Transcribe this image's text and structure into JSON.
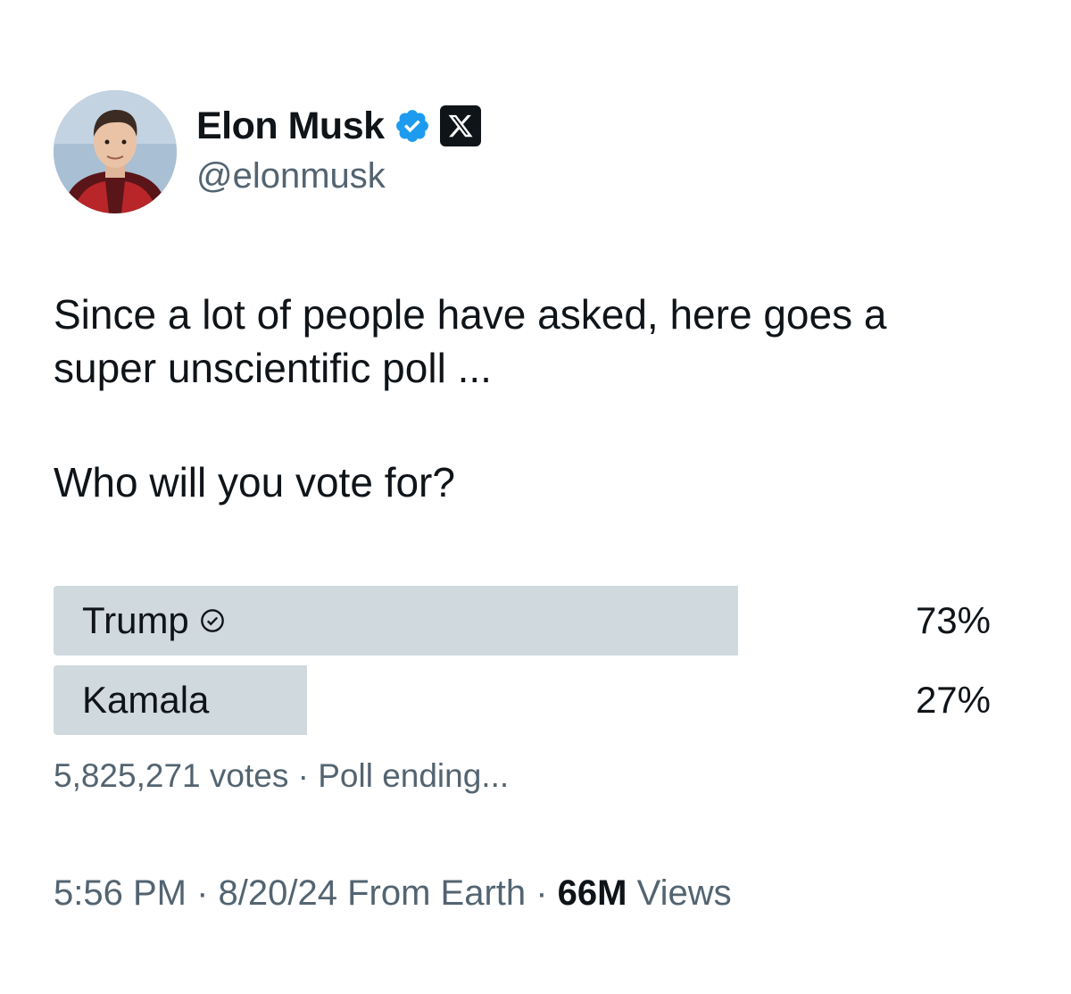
{
  "author": {
    "display_name": "Elon Musk",
    "handle": "@elonmusk",
    "avatar_icon": "profile-photo",
    "verified_icon": "verified-badge-icon",
    "affiliate_icon": "x-logo-icon"
  },
  "tweet": {
    "line1": "Since a lot of people have asked, here goes a",
    "line2": "super unscientific poll ...",
    "question": "Who will you vote for?"
  },
  "poll": {
    "options": [
      {
        "label": "Trump",
        "percent": 73,
        "percent_text": "73%",
        "selected": true
      },
      {
        "label": "Kamala",
        "percent": 27,
        "percent_text": "27%",
        "selected": false
      }
    ],
    "votes": "5,825,271 votes",
    "separator": " · ",
    "status": "Poll ending..."
  },
  "footer": {
    "time": "5:56 PM",
    "separator": " · ",
    "date_source": "8/20/24 From Earth",
    "views_count": "66M",
    "views_label": "Views"
  },
  "colors": {
    "verified": "#1d9bf0",
    "poll_bar": "#cfd9de",
    "secondary_text": "#536471",
    "primary_text": "#0f1419"
  }
}
